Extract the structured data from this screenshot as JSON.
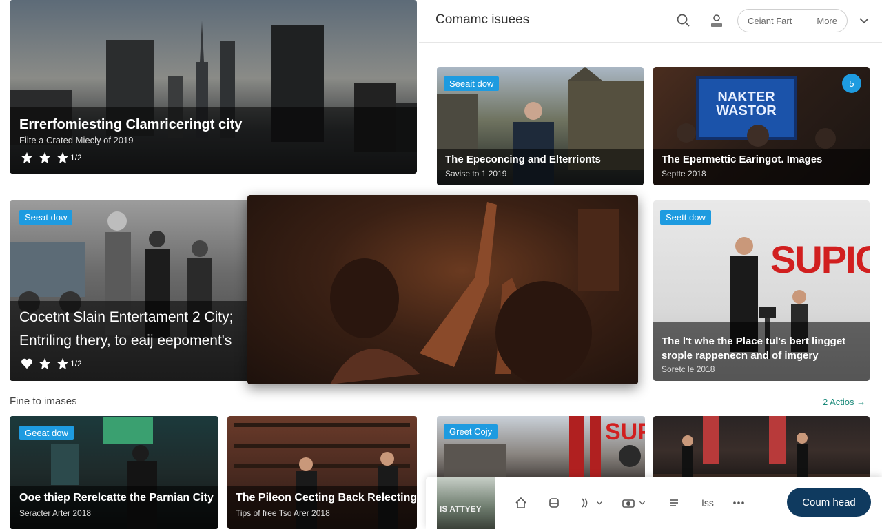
{
  "header": {
    "title": "Comamc isuees",
    "pill_left": "Ceiant Fart",
    "pill_right": "More"
  },
  "cards": {
    "hero": {
      "title": "Errerfomiesting Clamriceringt city",
      "subtitle": "Fiite a Crated Miecly of 2019"
    },
    "castle": {
      "badge": "Seeait dow",
      "title": "The Epeconcing and Elterrionts",
      "subtitle": "Savise to 1 2019"
    },
    "screen": {
      "badge_count": "5",
      "screen_text": "NAKTER WASTOR",
      "title": "The Epermettic Earingot. Images",
      "subtitle": "Septte 2018"
    },
    "bw": {
      "badge": "Seeat dow",
      "title_line1": "Cocetnt Slain Entertament 2 City;",
      "title_line2": "Entriling thery, to eaij eepoment's",
      "rating_text": "1/2"
    },
    "gallery": {
      "badge": "Seett dow",
      "wall_text": "SUPICA",
      "title_line1": "The l't whe the Place tul's bert lingget",
      "title_line2": "srople rappenecn and of imgery",
      "subtitle": "Soretc le 2018"
    },
    "bar": {
      "badge": "Geeat dow",
      "title": "Ooe thiep Rerelcatte the Parnian City",
      "subtitle": "Seracter Arter 2018"
    },
    "library": {
      "title": "The Pileon Cecting Back Relecting.",
      "subtitle": "Tips of free Tso Arer 2018"
    },
    "tower": {
      "badge": "Greet Cojy",
      "wall_text": "SUPU"
    }
  },
  "hero_rating_text": "1/2",
  "section": {
    "label": "Fine to imases",
    "link": "2 Actios →"
  },
  "toolbar": {
    "thumb_text": "IS ATTYEY",
    "iss_label": "Iss",
    "cta": "Coum head"
  },
  "colors": {
    "badge_blue": "#1e9be0",
    "cta_navy": "#0f3a5f",
    "link_teal": "#1a8a7a"
  }
}
